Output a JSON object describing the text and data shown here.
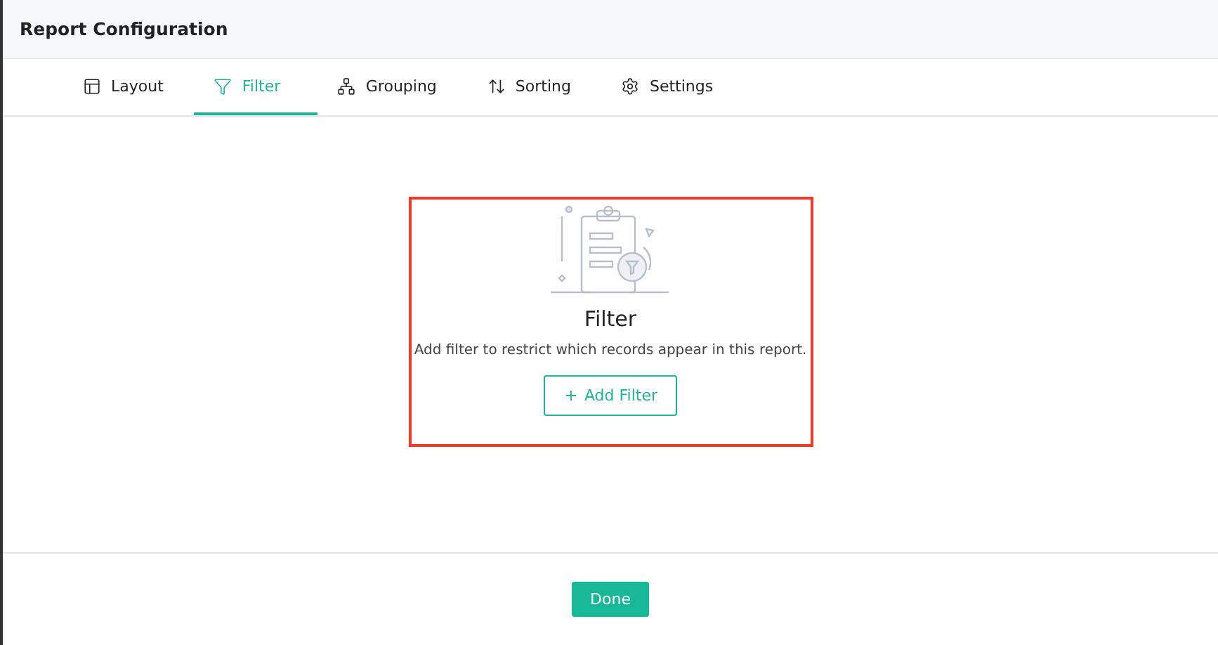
{
  "window": {
    "title": "Report Configuration"
  },
  "tabs": [
    {
      "label": "Layout",
      "kind": "layout",
      "selected": false
    },
    {
      "label": "Filter",
      "kind": "filter",
      "selected": true
    },
    {
      "label": "Grouping",
      "kind": "grouping",
      "selected": false
    },
    {
      "label": "Sorting",
      "kind": "sorting",
      "selected": false
    },
    {
      "label": "Settings",
      "kind": "settings",
      "selected": false
    }
  ],
  "empty_state": {
    "title": "Filter",
    "description": "Add filter to restrict which records appear in this report.",
    "button": "Add Filter"
  },
  "footer": {
    "button": "Done"
  }
}
